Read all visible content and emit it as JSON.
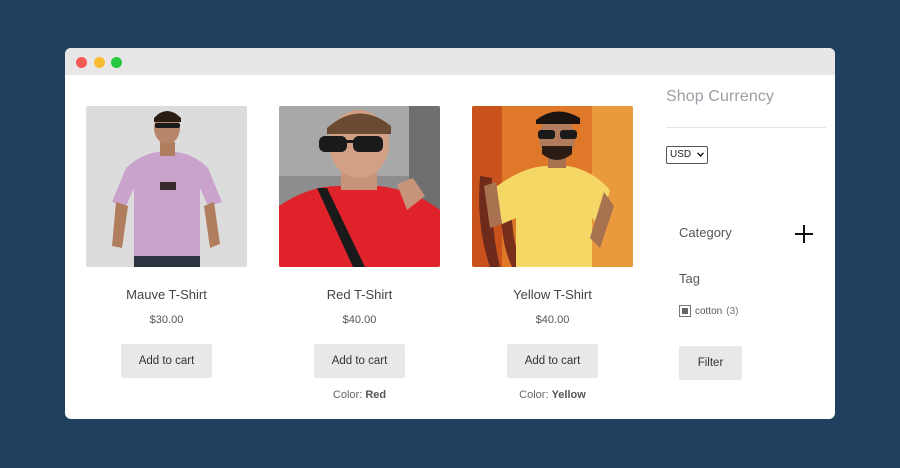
{
  "products": [
    {
      "title": "Mauve T-Shirt",
      "price": "$30.00",
      "add_to_cart": "Add to cart",
      "variant_label": "",
      "variant_value": "",
      "shirt_color": "#c9a3cc",
      "bg_color": "#dcdcdc"
    },
    {
      "title": "Red T-Shirt",
      "price": "$40.00",
      "add_to_cart": "Add to cart",
      "variant_label": "Color: ",
      "variant_value": "Red",
      "shirt_color": "#e0222b",
      "bg_color": "#8d8d8d"
    },
    {
      "title": "Yellow T-Shirt",
      "price": "$40.00",
      "add_to_cart": "Add to cart",
      "variant_label": "Color: ",
      "variant_value": "Yellow",
      "shirt_color": "#f5d766",
      "bg_color": "#e0782a"
    }
  ],
  "sidebar": {
    "currency_heading": "Shop Currency",
    "currency_value": "USD",
    "category_heading": "Category",
    "tag_heading": "Tag",
    "tag_label": "cotton",
    "tag_count": "(3)",
    "filter_label": "Filter"
  },
  "colors": {
    "page_background": "#1f405f",
    "button_background": "#e8e8e8"
  }
}
